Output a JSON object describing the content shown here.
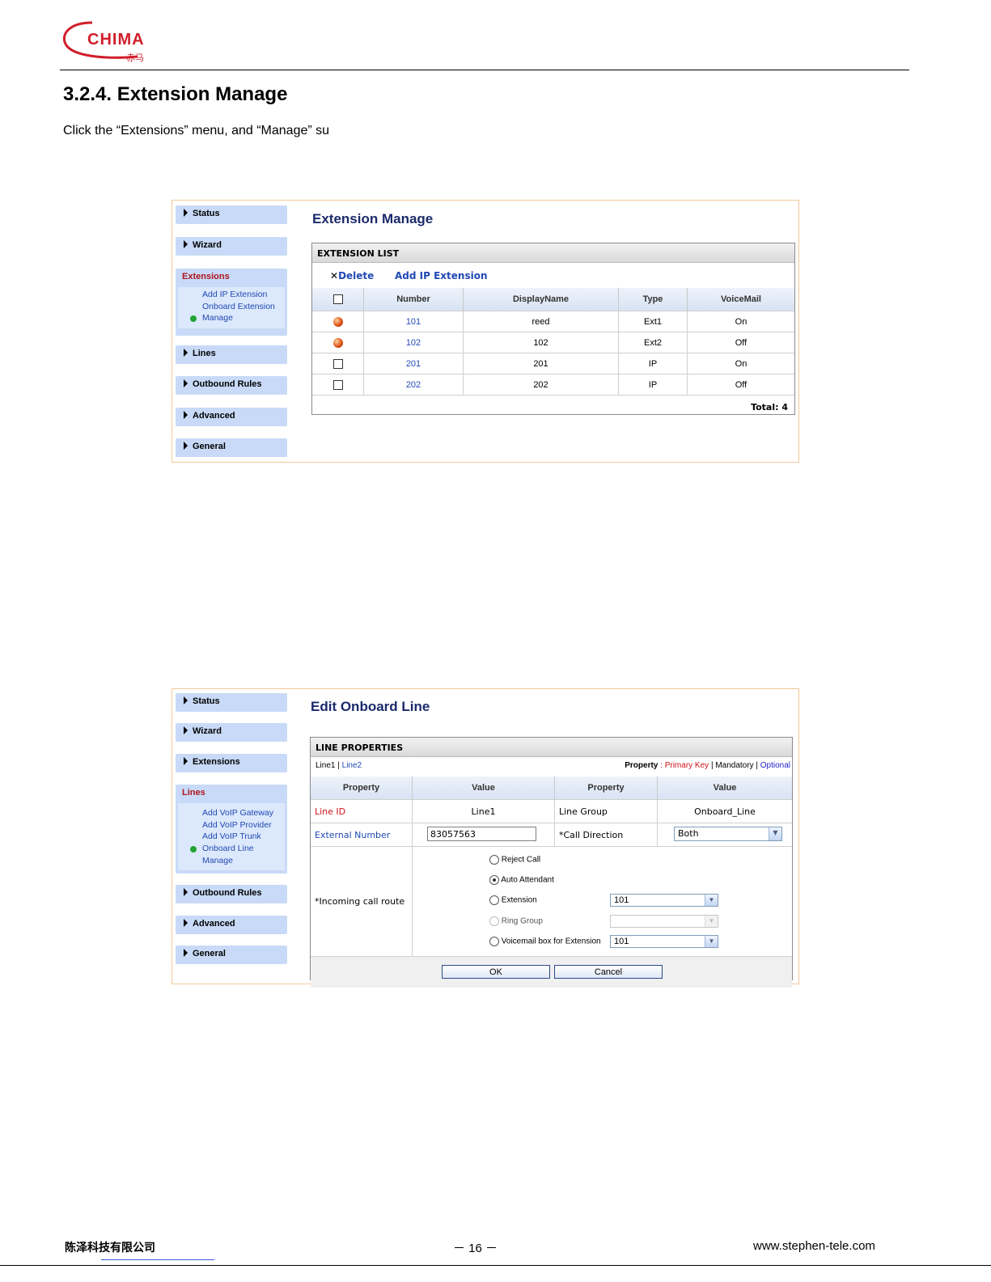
{
  "header": {
    "logo_text": "CHIMA",
    "logo_sub": "赤马"
  },
  "section_title": "3.2.4. Extension Manage",
  "intro": "Click the “Extensions” menu, and “Manage” su",
  "shot1": {
    "nav": {
      "status": "Status",
      "wizard": "Wizard",
      "extensions": "Extensions",
      "ext_sub": [
        "Add IP Extension",
        "Onboard Extension",
        "Manage"
      ],
      "lines": "Lines",
      "outbound": "Outbound Rules",
      "advanced": "Advanced",
      "general": "General"
    },
    "title": "Extension Manage",
    "list_header": "EXTENSION LIST",
    "delete_label": "Delete",
    "add_label": "Add IP Extension",
    "columns": [
      "Number",
      "DisplayName",
      "Type",
      "VoiceMail"
    ],
    "rows": [
      {
        "number": "101",
        "display": "reed",
        "type": "Ext1",
        "voicemail": "On",
        "marker": "ball"
      },
      {
        "number": "102",
        "display": "102",
        "type": "Ext2",
        "voicemail": "Off",
        "marker": "ball"
      },
      {
        "number": "201",
        "display": "201",
        "type": "IP",
        "voicemail": "On",
        "marker": "checkbox"
      },
      {
        "number": "202",
        "display": "202",
        "type": "IP",
        "voicemail": "Off",
        "marker": "checkbox"
      }
    ],
    "total": "Total: 4"
  },
  "shot2": {
    "nav": {
      "status": "Status",
      "wizard": "Wizard",
      "extensions": "Extensions",
      "lines": "Lines",
      "lines_sub": [
        "Add VoIP Gateway",
        "Add VoIP Provider",
        "Add VoIP Trunk",
        "Onboard Line",
        "Manage"
      ],
      "outbound": "Outbound Rules",
      "advanced": "Advanced",
      "general": "General"
    },
    "title": "Edit Onboard Line",
    "props_header": "LINE PROPERTIES",
    "line1": "Line1",
    "sep": "|",
    "line2": "Line2",
    "legend_property": "Property",
    "legend_colon": ":",
    "legend_primary": "Primary Key",
    "legend_mandatory": "Mandatory",
    "legend_optional": "Optional",
    "columns": [
      "Property",
      "Value",
      "Property",
      "Value"
    ],
    "line_id_label": "Line ID",
    "line_id_value": "Line1",
    "line_group_label": "Line Group",
    "line_group_value": "Onboard_Line",
    "ext_number_label": "External Number",
    "ext_number_value": "83057563",
    "call_dir_label": "*Call Direction",
    "call_dir_value": "Both",
    "incoming_label": "*Incoming call route",
    "opt_reject": "Reject Call",
    "opt_auto": "Auto Attendant",
    "opt_extension": "Extension",
    "opt_extension_value": "101",
    "opt_ring": "Ring Group",
    "opt_voicemail": "Voicemail box for Extension",
    "opt_voicemail_value": "101",
    "ok": "OK",
    "cancel": "Cancel"
  },
  "footer": {
    "company": "陈泽科技有限公司",
    "page": "－ 16 －",
    "website": "www.stephen-tele.com"
  }
}
